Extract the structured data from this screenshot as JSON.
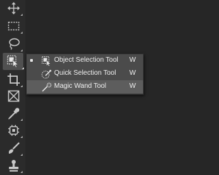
{
  "toolbar": {
    "tools": [
      {
        "name": "move-tool"
      },
      {
        "name": "rectangular-marquee-tool"
      },
      {
        "name": "lasso-tool"
      },
      {
        "name": "object-selection-tool",
        "active": true
      },
      {
        "name": "crop-tool"
      },
      {
        "name": "frame-tool"
      },
      {
        "name": "eyedropper-tool"
      },
      {
        "name": "spot-healing-brush-tool"
      },
      {
        "name": "brush-tool"
      },
      {
        "name": "clone-stamp-tool"
      }
    ]
  },
  "flyout": {
    "items": [
      {
        "label": "Object Selection Tool",
        "shortcut": "W",
        "icon": "object-selection-icon",
        "selected": true
      },
      {
        "label": "Quick Selection Tool",
        "shortcut": "W",
        "icon": "quick-selection-icon"
      },
      {
        "label": "Magic Wand Tool",
        "shortcut": "W",
        "icon": "magic-wand-icon",
        "highlighted": true
      }
    ]
  }
}
